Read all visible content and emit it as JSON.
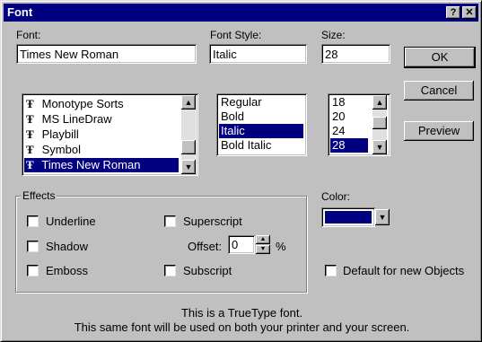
{
  "window": {
    "title": "Font",
    "help_label": "?",
    "close_label": "✕"
  },
  "font": {
    "label": "Font:",
    "value": "Times New Roman",
    "items": [
      "Monotype Sorts",
      "MS LineDraw",
      "Playbill",
      "Symbol",
      "Times New Roman"
    ],
    "selected_index": 4
  },
  "style": {
    "label": "Font Style:",
    "value": "Italic",
    "items": [
      "Regular",
      "Bold",
      "Italic",
      "Bold Italic"
    ],
    "selected_index": 2
  },
  "size": {
    "label": "Size:",
    "value": "28",
    "items": [
      "18",
      "20",
      "24",
      "28"
    ],
    "selected_index": 3
  },
  "buttons": {
    "ok": "OK",
    "cancel": "Cancel",
    "preview": "Preview"
  },
  "effects": {
    "label": "Effects",
    "underline": "Underline",
    "shadow": "Shadow",
    "emboss": "Emboss",
    "superscript": "Superscript",
    "subscript": "Subscript",
    "offset_label": "Offset:",
    "offset_value": "0",
    "offset_unit": "%"
  },
  "color": {
    "label": "Color:",
    "value_color": "#000080"
  },
  "default_label": "Default for new Objects",
  "footer": {
    "line1": "This is a TrueType font.",
    "line2": "This same font will be used on both your printer and your screen."
  },
  "icons": {
    "truetype": "truetype-font-icon"
  }
}
